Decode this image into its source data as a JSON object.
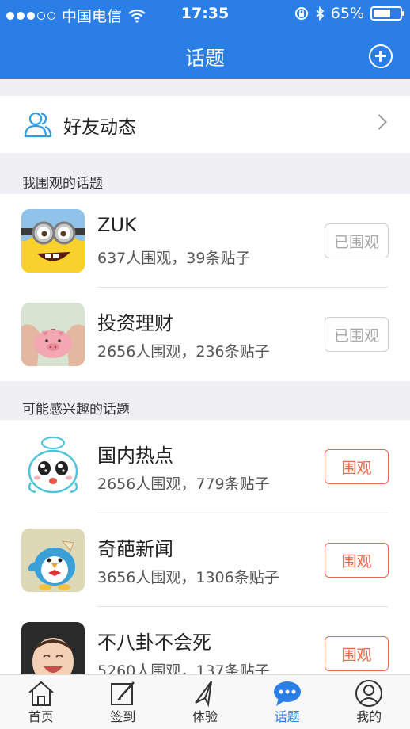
{
  "status_bar": {
    "carrier": "中国电信",
    "time": "17:35",
    "battery_percent": "65%",
    "battery_level": 0.65
  },
  "nav": {
    "title": "话题",
    "add_icon": "plus-circle-icon"
  },
  "friends": {
    "label": "好友动态",
    "icon": "users-icon"
  },
  "sections": {
    "followed_title": "我围观的话题",
    "suggested_title": "可能感兴趣的话题"
  },
  "followed_topics": [
    {
      "name": "ZUK",
      "meta": "637人围观，39条贴子",
      "button": "已围观"
    },
    {
      "name": "投资理财",
      "meta": "2656人围观，236条贴子",
      "button": "已围观"
    }
  ],
  "suggested_topics": [
    {
      "name": "国内热点",
      "meta": "2656人围观，779条贴子",
      "button": "围观"
    },
    {
      "name": "奇葩新闻",
      "meta": "3656人围观，1306条贴子",
      "button": "围观"
    },
    {
      "name": "不八卦不会死",
      "meta": "5260人围观，137条贴子",
      "button": "围观"
    }
  ],
  "tabs": [
    {
      "label": "首页",
      "icon": "home-icon",
      "active": false
    },
    {
      "label": "签到",
      "icon": "edit-icon",
      "active": false
    },
    {
      "label": "体验",
      "icon": "paper-plane-icon",
      "active": false
    },
    {
      "label": "话题",
      "icon": "chat-bubble-icon",
      "active": true
    },
    {
      "label": "我的",
      "icon": "user-icon",
      "active": false
    }
  ],
  "colors": {
    "brand": "#2b7ee6",
    "follow_accent": "#e8694d",
    "followed_gray": "#a8a8a8"
  }
}
